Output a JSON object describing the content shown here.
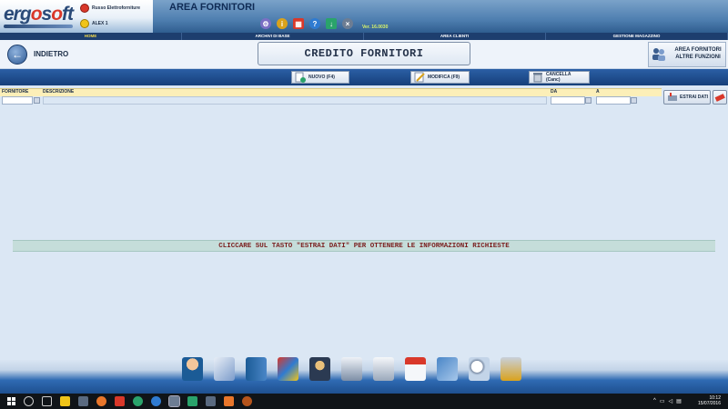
{
  "header": {
    "logo_text": "ergosoft",
    "company_name": "Russo Elettroforniture",
    "user_name": "ALEX 1",
    "area_title": "AREA FORNITORI",
    "version": "Ver. 16.0030",
    "toolbar_icons": [
      "gear-icon",
      "info-icon",
      "calculator-icon",
      "help-icon",
      "download-icon",
      "close-icon"
    ]
  },
  "menu": {
    "items": [
      "HOME",
      "ARCHIVI DI BASE",
      "AREA CLIENTI",
      "GESTIONE MAGAZZINO"
    ]
  },
  "title_row": {
    "back_label": "INDIETRO",
    "page_title": "CREDITO FORNITORI",
    "area_functions_line1": "AREA FORNITORI",
    "area_functions_line2": "ALTRE FUNZIONI"
  },
  "actions": {
    "new_label": "NUOVO (F4)",
    "edit_label": "MODIFICA (F9)",
    "delete_label": "CANCELLA (Canc)"
  },
  "filters": {
    "supplier_label": "FORNITORE",
    "description_label": "DESCRIZIONE",
    "from_label": "DA",
    "to_label": "A",
    "supplier_value": "",
    "description_value": "",
    "from_value": "",
    "to_value": "",
    "extract_label": "ESTRAI DATI"
  },
  "content": {
    "message": "CLICCARE SUL TASTO \"ESTRAI DATI\" PER OTTENERE LE INFORMAZIONI RICHIESTE"
  },
  "dock": {
    "icons": [
      "customer-icon",
      "payment-card-icon",
      "binder-icon",
      "documents-icon",
      "security-icon",
      "database-icon",
      "printer-icon",
      "calendar-clock-icon",
      "tags-icon",
      "search-icon",
      "tools-icon"
    ]
  },
  "taskbar": {
    "time": "10:12",
    "date": "15/07/2016"
  },
  "colors": {
    "accent": "#1d3e6e",
    "message_text": "#7a1d1d",
    "filter_bar": "#fcefb8"
  }
}
